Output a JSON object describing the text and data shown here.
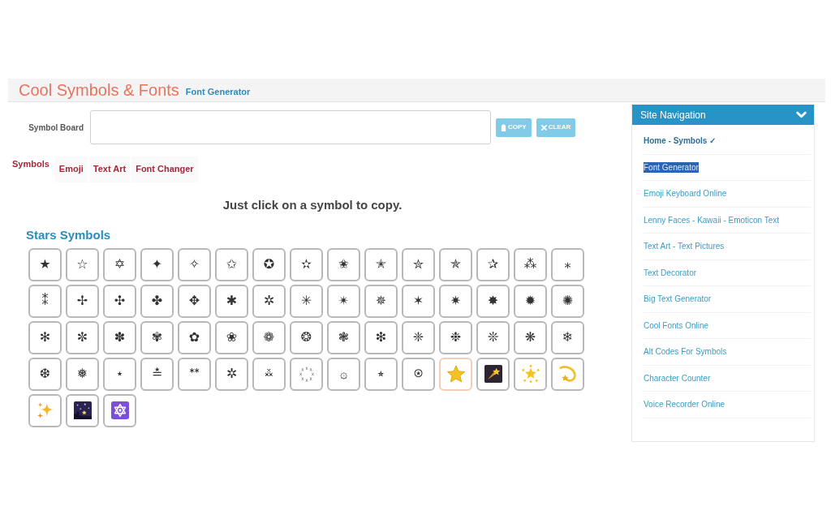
{
  "header": {
    "title": "Cool Symbols & Fonts",
    "link": "Font Generator"
  },
  "symbol_board": {
    "label": "Symbol Board",
    "buttons": [
      {
        "kind": "copy",
        "label": "COPY"
      },
      {
        "kind": "clear",
        "label": "CLEAR"
      }
    ]
  },
  "tabs": [
    {
      "label": "Symbols",
      "selected": true
    },
    {
      "label": "Emoji",
      "selected": false
    },
    {
      "label": "Text Art",
      "selected": false
    },
    {
      "label": "Font Changer",
      "selected": false
    }
  ],
  "instruction": "Just click on a symbol to copy.",
  "section": {
    "title": "Stars Symbols",
    "symbols": [
      {
        "kind": "char",
        "symbol": "★",
        "hovered": false
      },
      {
        "kind": "char",
        "symbol": "☆",
        "hovered": false
      },
      {
        "kind": "char",
        "symbol": "✡",
        "hovered": false
      },
      {
        "kind": "char",
        "symbol": "✦",
        "hovered": false
      },
      {
        "kind": "char",
        "symbol": "✧",
        "hovered": false
      },
      {
        "kind": "char",
        "symbol": "✩",
        "hovered": false
      },
      {
        "kind": "char",
        "symbol": "✪",
        "hovered": false
      },
      {
        "kind": "char",
        "symbol": "✫",
        "hovered": false
      },
      {
        "kind": "char",
        "symbol": "✬",
        "hovered": false
      },
      {
        "kind": "char",
        "symbol": "✭",
        "hovered": false
      },
      {
        "kind": "char",
        "symbol": "✮",
        "hovered": false
      },
      {
        "kind": "char",
        "symbol": "✯",
        "hovered": false
      },
      {
        "kind": "char",
        "symbol": "✰",
        "hovered": false
      },
      {
        "kind": "char",
        "symbol": "⁂",
        "hovered": false
      },
      {
        "kind": "char",
        "symbol": "⁎",
        "hovered": false
      },
      {
        "kind": "char",
        "symbol": "⁑",
        "hovered": false
      },
      {
        "kind": "char",
        "symbol": "✢",
        "hovered": false
      },
      {
        "kind": "char",
        "symbol": "✣",
        "hovered": false
      },
      {
        "kind": "char",
        "symbol": "✤",
        "hovered": false
      },
      {
        "kind": "char",
        "symbol": "✥",
        "hovered": false
      },
      {
        "kind": "char",
        "symbol": "✱",
        "hovered": false
      },
      {
        "kind": "char",
        "symbol": "✲",
        "hovered": false
      },
      {
        "kind": "char",
        "symbol": "✳",
        "hovered": false
      },
      {
        "kind": "char",
        "symbol": "✴",
        "hovered": false
      },
      {
        "kind": "char",
        "symbol": "✵",
        "hovered": false
      },
      {
        "kind": "char",
        "symbol": "✶",
        "hovered": false
      },
      {
        "kind": "char",
        "symbol": "✷",
        "hovered": false
      },
      {
        "kind": "char",
        "symbol": "✸",
        "hovered": false
      },
      {
        "kind": "char",
        "symbol": "✹",
        "hovered": false
      },
      {
        "kind": "char",
        "symbol": "✺",
        "hovered": false
      },
      {
        "kind": "char",
        "symbol": "✻",
        "hovered": false
      },
      {
        "kind": "char",
        "symbol": "✼",
        "hovered": false
      },
      {
        "kind": "char",
        "symbol": "✽",
        "hovered": false
      },
      {
        "kind": "char",
        "symbol": "✾",
        "hovered": false
      },
      {
        "kind": "char",
        "symbol": "✿",
        "hovered": false
      },
      {
        "kind": "char",
        "symbol": "❀",
        "hovered": false
      },
      {
        "kind": "char",
        "symbol": "❁",
        "hovered": false
      },
      {
        "kind": "char",
        "symbol": "❂",
        "hovered": false
      },
      {
        "kind": "char",
        "symbol": "❃",
        "hovered": false
      },
      {
        "kind": "char",
        "symbol": "❇",
        "hovered": false
      },
      {
        "kind": "char",
        "symbol": "❈",
        "hovered": false
      },
      {
        "kind": "char",
        "symbol": "❉",
        "hovered": false
      },
      {
        "kind": "char",
        "symbol": "❊",
        "hovered": false
      },
      {
        "kind": "char",
        "symbol": "❋",
        "hovered": false
      },
      {
        "kind": "char",
        "symbol": "❄",
        "hovered": false
      },
      {
        "kind": "char",
        "symbol": "❆",
        "hovered": false
      },
      {
        "kind": "char",
        "symbol": "❅",
        "hovered": false
      },
      {
        "kind": "char",
        "symbol": "⋆",
        "hovered": false
      },
      {
        "kind": "char",
        "symbol": "≛",
        "hovered": false
      },
      {
        "kind": "char",
        "symbol": "ᕯ",
        "hovered": false
      },
      {
        "kind": "char",
        "symbol": "✲",
        "hovered": false
      },
      {
        "kind": "char",
        "symbol": "࿏",
        "hovered": false
      },
      {
        "kind": "char",
        "symbol": "꙰",
        "hovered": false
      },
      {
        "kind": "char",
        "symbol": "۞",
        "hovered": false
      },
      {
        "kind": "char",
        "symbol": "⭒",
        "hovered": false
      },
      {
        "kind": "char",
        "symbol": "⍟",
        "hovered": false
      },
      {
        "kind": "star",
        "hovered": true
      },
      {
        "kind": "shootingstar",
        "hovered": false
      },
      {
        "kind": "glowingstar",
        "hovered": false
      },
      {
        "kind": "dizzy",
        "hovered": false
      },
      {
        "kind": "sparkles",
        "hovered": false
      },
      {
        "kind": "nightsky",
        "hovered": false
      },
      {
        "kind": "hexagram",
        "hovered": false
      }
    ]
  },
  "sidebar": {
    "title": "Site Navigation",
    "items": [
      {
        "label": "Home - Symbols ✓",
        "current": true,
        "highlighted": false
      },
      {
        "label": "Font Generator",
        "current": false,
        "highlighted": true
      },
      {
        "label": "Emoji Keyboard Online",
        "current": false,
        "highlighted": false
      },
      {
        "label": "Lenny Faces - Kawaii - Emoticon Text",
        "current": false,
        "highlighted": false
      },
      {
        "label": "Text Art - Text Pictures",
        "current": false,
        "highlighted": false
      },
      {
        "label": "Text Decorator",
        "current": false,
        "highlighted": false
      },
      {
        "label": "Big Text Generator",
        "current": false,
        "highlighted": false
      },
      {
        "label": "Cool Fonts Online",
        "current": false,
        "highlighted": false
      },
      {
        "label": "Alt Codes For Symbols",
        "current": false,
        "highlighted": false
      },
      {
        "label": "Character Counter",
        "current": false,
        "highlighted": false
      },
      {
        "label": "Voice Recorder Online",
        "current": false,
        "highlighted": false
      }
    ]
  }
}
